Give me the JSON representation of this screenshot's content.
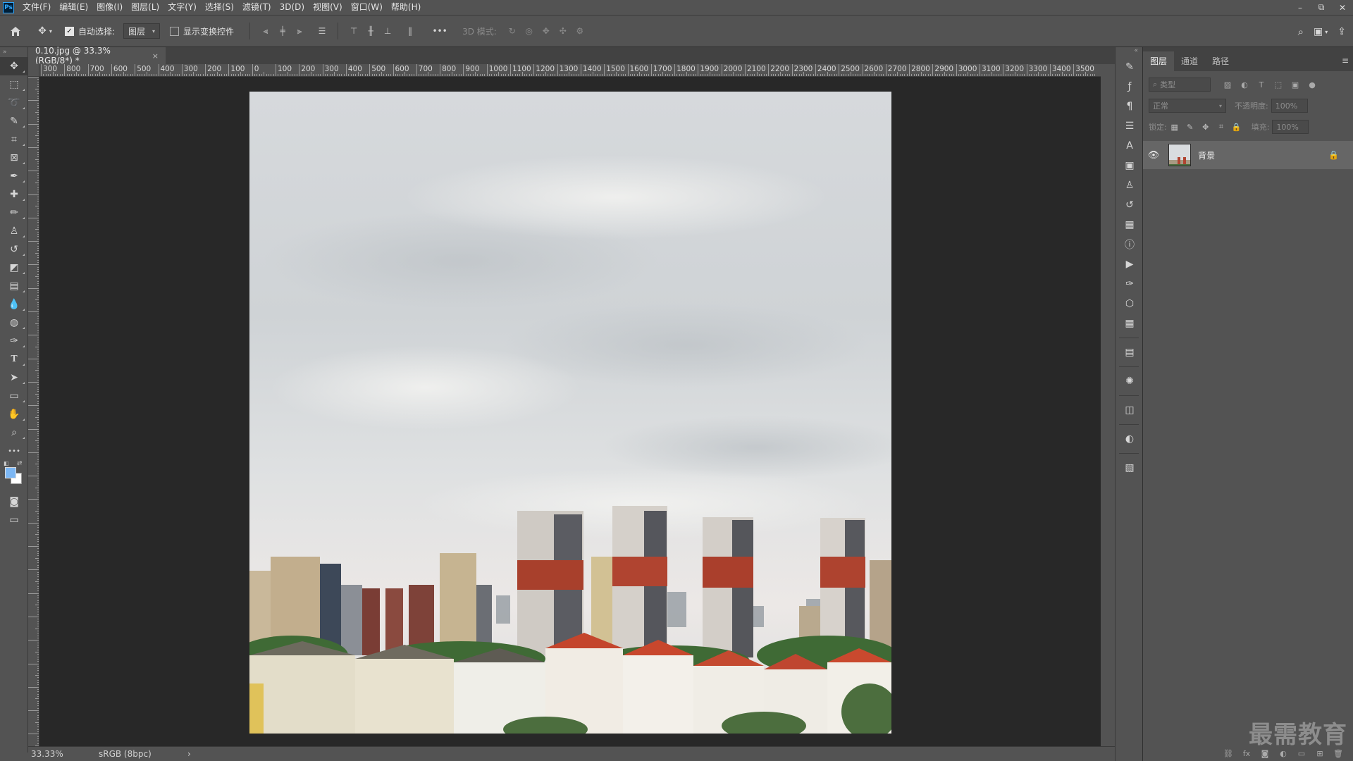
{
  "app": {
    "logo": "Ps"
  },
  "menu": [
    "文件(F)",
    "编辑(E)",
    "图像(I)",
    "图层(L)",
    "文字(Y)",
    "选择(S)",
    "滤镜(T)",
    "3D(D)",
    "视图(V)",
    "窗口(W)",
    "帮助(H)"
  ],
  "window_controls": {
    "minimize": "–",
    "restore": "⧉",
    "close": "✕"
  },
  "options": {
    "auto_select_label": "自动选择:",
    "auto_select_checked": true,
    "auto_select_value": "图层",
    "show_transform_label": "显示变换控件",
    "show_transform_checked": false,
    "more": "•••",
    "mode_3d_label": "3D 模式:"
  },
  "document": {
    "tab_title": "0.10.jpg @ 33.3%(RGB/8*) *",
    "tab_close": "×",
    "zoom": "33.33%",
    "color_profile": "sRGB (8bpc)",
    "status_arrow": "›"
  },
  "ruler": {
    "top_labels": [
      "300",
      "800",
      "700",
      "600",
      "500",
      "400",
      "300",
      "200",
      "100",
      "0",
      "100",
      "200",
      "300",
      "400",
      "500",
      "600",
      "700",
      "800",
      "900",
      "1000",
      "1100",
      "1200",
      "1300",
      "1400",
      "1500",
      "1600",
      "1700",
      "1800",
      "1900",
      "2000",
      "2100",
      "2200",
      "2300",
      "2400",
      "2500",
      "2600",
      "2700",
      "2800",
      "2900",
      "3000",
      "3100",
      "3200",
      "3300",
      "3400",
      "3500"
    ]
  },
  "tools": [
    {
      "name": "move-tool",
      "glyph": "✥"
    },
    {
      "name": "marquee-tool",
      "glyph": "⬚"
    },
    {
      "name": "lasso-tool",
      "glyph": "➰"
    },
    {
      "name": "quick-select-tool",
      "glyph": "✎"
    },
    {
      "name": "crop-tool",
      "glyph": "⌗"
    },
    {
      "name": "frame-tool",
      "glyph": "⊠"
    },
    {
      "name": "eyedropper-tool",
      "glyph": "✒"
    },
    {
      "name": "healing-brush-tool",
      "glyph": "✚"
    },
    {
      "name": "brush-tool",
      "glyph": "✏"
    },
    {
      "name": "clone-stamp-tool",
      "glyph": "♙"
    },
    {
      "name": "history-brush-tool",
      "glyph": "↺"
    },
    {
      "name": "eraser-tool",
      "glyph": "◩"
    },
    {
      "name": "gradient-tool",
      "glyph": "▤"
    },
    {
      "name": "blur-tool",
      "glyph": "💧"
    },
    {
      "name": "dodge-tool",
      "glyph": "◍"
    },
    {
      "name": "pen-tool",
      "glyph": "✑"
    },
    {
      "name": "type-tool",
      "glyph": "T"
    },
    {
      "name": "path-select-tool",
      "glyph": "➤"
    },
    {
      "name": "rectangle-tool",
      "glyph": "▭"
    },
    {
      "name": "hand-tool",
      "glyph": "✋"
    },
    {
      "name": "zoom-tool",
      "glyph": "⌕"
    },
    {
      "name": "more-tools",
      "glyph": "•••"
    }
  ],
  "layers_panel": {
    "tabs": [
      "图层",
      "通道",
      "路径"
    ],
    "filter_placeholder": "类型",
    "blend_mode": "正常",
    "opacity_label": "不透明度:",
    "opacity_value": "100%",
    "lock_label": "锁定:",
    "fill_label": "填充:",
    "fill_value": "100%",
    "layers": [
      {
        "name": "背景",
        "visible": true,
        "locked": true
      }
    ]
  },
  "watermark": "最需教育",
  "colors": {
    "foreground": "#7cb7f4",
    "background": "#ffffff",
    "ui": "#535353",
    "canvas": "#282828"
  }
}
